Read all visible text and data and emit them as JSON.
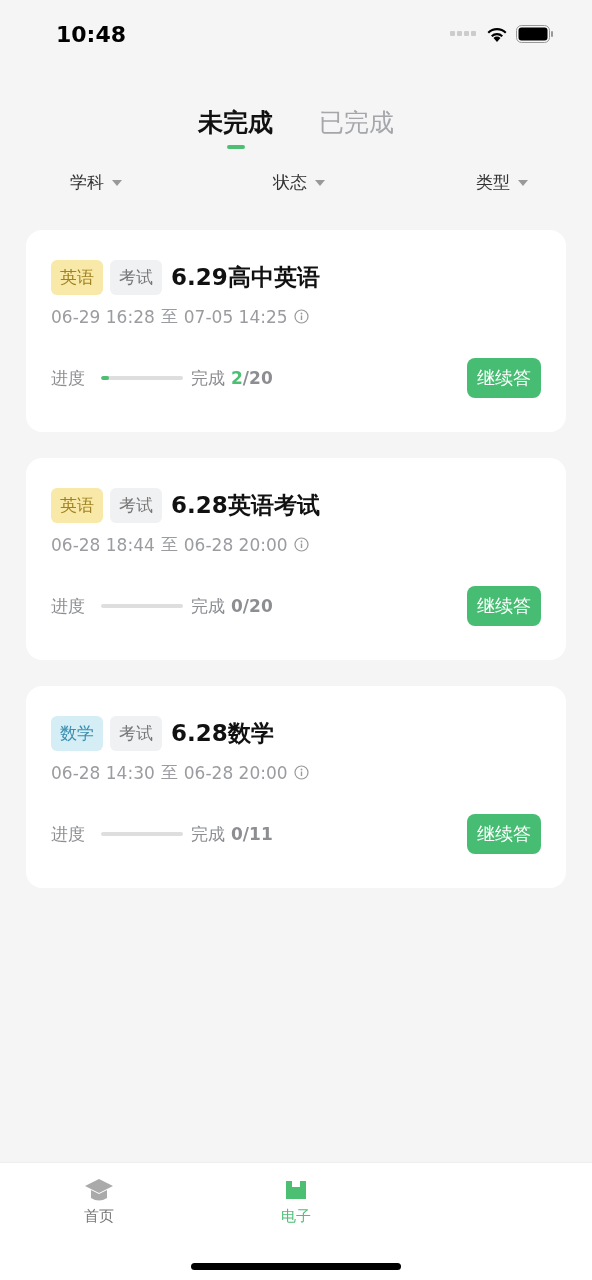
{
  "status_bar": {
    "time": "10:48"
  },
  "tabs": [
    {
      "label": "未完成",
      "selected": true
    },
    {
      "label": "已完成",
      "selected": false
    }
  ],
  "filters": [
    {
      "label": "学科"
    },
    {
      "label": "状态"
    },
    {
      "label": "类型"
    }
  ],
  "tasks": [
    {
      "subject": {
        "label": "英语",
        "color": "#f8e9a8"
      },
      "type_tag": "考试",
      "title": "6.29高中英语",
      "start": "06-29 16:28",
      "separator": "至",
      "end": "07-05 14:25",
      "progress_label": "进度",
      "level": 0.1,
      "done_label": "完成",
      "done": "2",
      "total": "/20",
      "button": "继续答"
    },
    {
      "subject": {
        "label": "英语",
        "color": "#f8e9a8"
      },
      "type_tag": "考试",
      "title": "6.28英语考试",
      "start": "06-28 18:44",
      "separator": "至",
      "end": "06-28 20:00",
      "progress_label": "进度",
      "done_label": "完成",
      "done": "0",
      "total": "/20",
      "button": "继续答"
    },
    {
      "subject": {
        "label": "数学",
        "color": "#d5eef6"
      },
      "type_tag": "考试",
      "title": "6.28数学",
      "start": "06-28 14:30",
      "separator": "至",
      "end": "06-28 20:00",
      "progress_label": "进度",
      "done_label": "完成",
      "done": "0",
      "total": "/11",
      "button": "继续答"
    }
  ],
  "tab_bar": [
    {
      "kind": "home",
      "label": "首页",
      "selected": false
    },
    {
      "kind": "book",
      "label": "电子",
      "selected": true
    }
  ]
}
